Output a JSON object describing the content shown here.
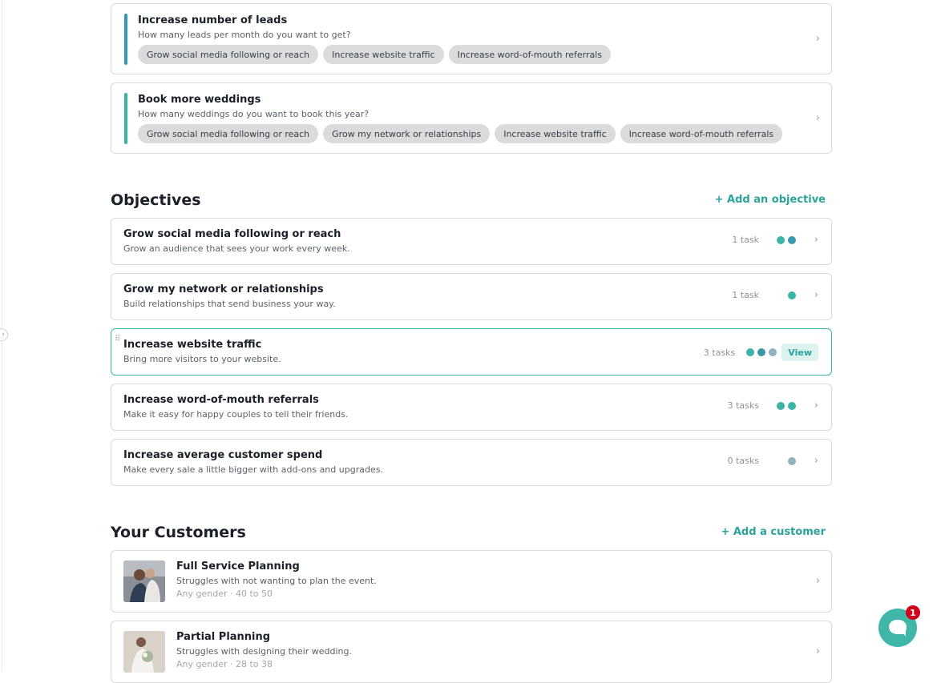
{
  "colors": {
    "accent": "#2aa39a",
    "goal_bar_blue": "#2e9bbd",
    "goal_bar_teal": "#36b3a3",
    "dot_teal": "#3bb3a6",
    "dot_blue": "#3a98ad",
    "dot_grey": "#8fb3bf",
    "badge_red": "#d0021b"
  },
  "goals": [
    {
      "title": "Increase number of leads",
      "subtitle": "How many leads per month do you want to get?",
      "chips": [
        "Grow social media following or reach",
        "Increase website traffic",
        "Increase word-of-mouth referrals"
      ],
      "chevron": "›"
    },
    {
      "title": "Book more weddings",
      "subtitle": "How many weddings do you want to book this year?",
      "chips": [
        "Grow social media following or reach",
        "Grow my network or relationships",
        "Increase website traffic",
        "Increase word-of-mouth referrals"
      ],
      "chevron": "›"
    }
  ],
  "objectives": {
    "heading": "Objectives",
    "add_label": "+ Add an objective",
    "items": [
      {
        "title": "Grow social media following or reach",
        "subtitle": "Grow an audience that sees your work every week.",
        "tasks": "1 task",
        "chevron": "›"
      },
      {
        "title": "Grow my network or relationships",
        "subtitle": "Build relationships that send business your way.",
        "tasks": "1 task",
        "chevron": "›"
      },
      {
        "title": "Increase website traffic",
        "subtitle": "Bring more visitors to your website.",
        "tasks": "3 tasks",
        "view_label": "View",
        "drag_handle": "⠿"
      },
      {
        "title": "Increase word-of-mouth referrals",
        "subtitle": "Make it easy for happy couples to tell their friends.",
        "tasks": "3 tasks",
        "chevron": "›"
      },
      {
        "title": "Increase average customer spend",
        "subtitle": "Make every sale a little bigger with add-ons and upgrades.",
        "tasks": "0 tasks",
        "chevron": "›"
      }
    ]
  },
  "customers": {
    "heading": "Your Customers",
    "add_label": "+ Add a customer",
    "items": [
      {
        "title": "Full Service Planning",
        "subtitle": "Struggles with not wanting to plan the event.",
        "meta": "Any gender · 40 to 50",
        "chevron": "›"
      },
      {
        "title": "Partial Planning",
        "subtitle": "Struggles with designing their wedding.",
        "meta": "Any gender · 28 to 38",
        "chevron": "›"
      }
    ]
  },
  "chat": {
    "badge": "1"
  },
  "sidebar_toggle": "‹"
}
